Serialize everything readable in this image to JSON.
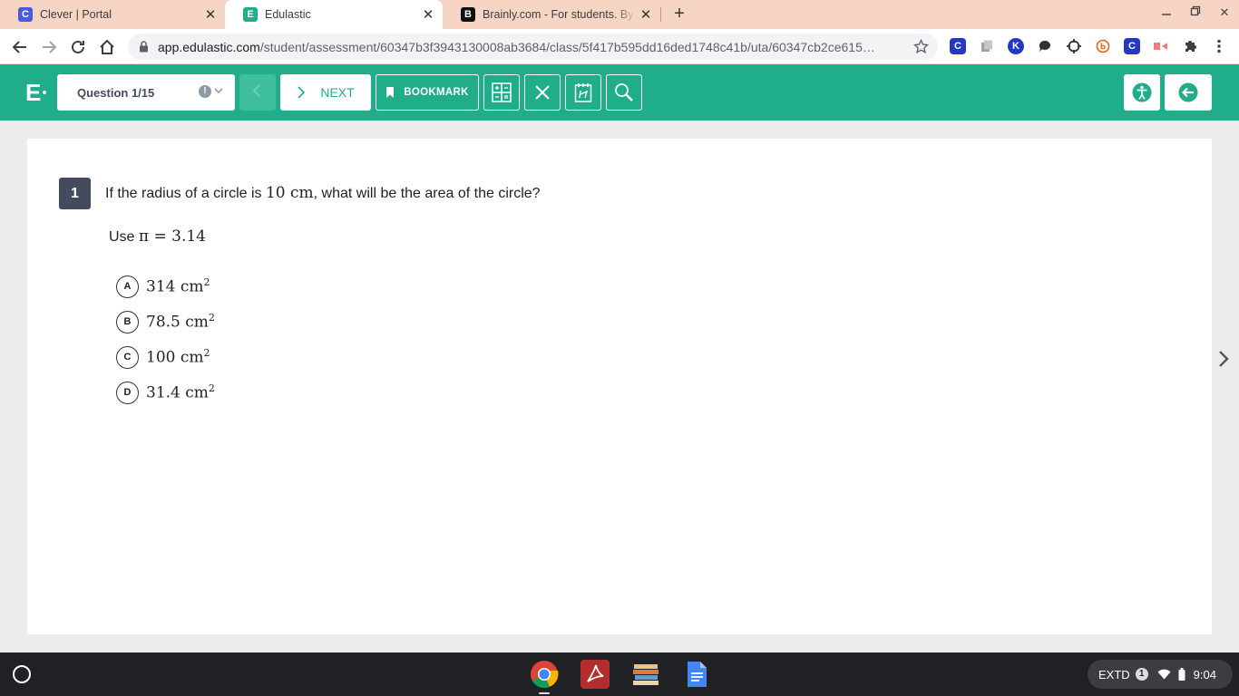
{
  "browser": {
    "tabs": [
      {
        "title": "Clever | Portal",
        "favicon": "C",
        "favicon_color": "#4a5bdc",
        "active": false
      },
      {
        "title": "Edulastic",
        "favicon": "E",
        "favicon_color": "#1fae89",
        "active": true
      },
      {
        "title": "Brainly.com - For students. By students",
        "favicon": "B",
        "favicon_color": "#111111",
        "active": false
      }
    ],
    "url_host": "app.edulastic.com",
    "url_path": "/student/assessment/60347b3f3943130008ab3684/class/5f417b595dd16ded1748c41b/uta/60347cb2ce615…"
  },
  "app": {
    "logo": "E",
    "question_selector": "Question 1/15",
    "next_label": "NEXT",
    "bookmark_label": "BOOKMARK",
    "accent_color": "#1fae89"
  },
  "question": {
    "number": "1",
    "stem_before": "If the radius of a circle is ",
    "stem_value": "10 cm",
    "stem_after": ", what will be the area of the circle?",
    "hint_prefix": "Use ",
    "hint_math": "π = 3.14",
    "options": [
      {
        "letter": "A",
        "value": "314 cm",
        "exp": "2"
      },
      {
        "letter": "B",
        "value": "78.5 cm",
        "exp": "2"
      },
      {
        "letter": "C",
        "value": "100 cm",
        "exp": "2"
      },
      {
        "letter": "D",
        "value": "31.4 cm",
        "exp": "2"
      }
    ]
  },
  "shelf": {
    "extd_label": "EXTD",
    "notification_count": "1",
    "time": "9:04"
  }
}
